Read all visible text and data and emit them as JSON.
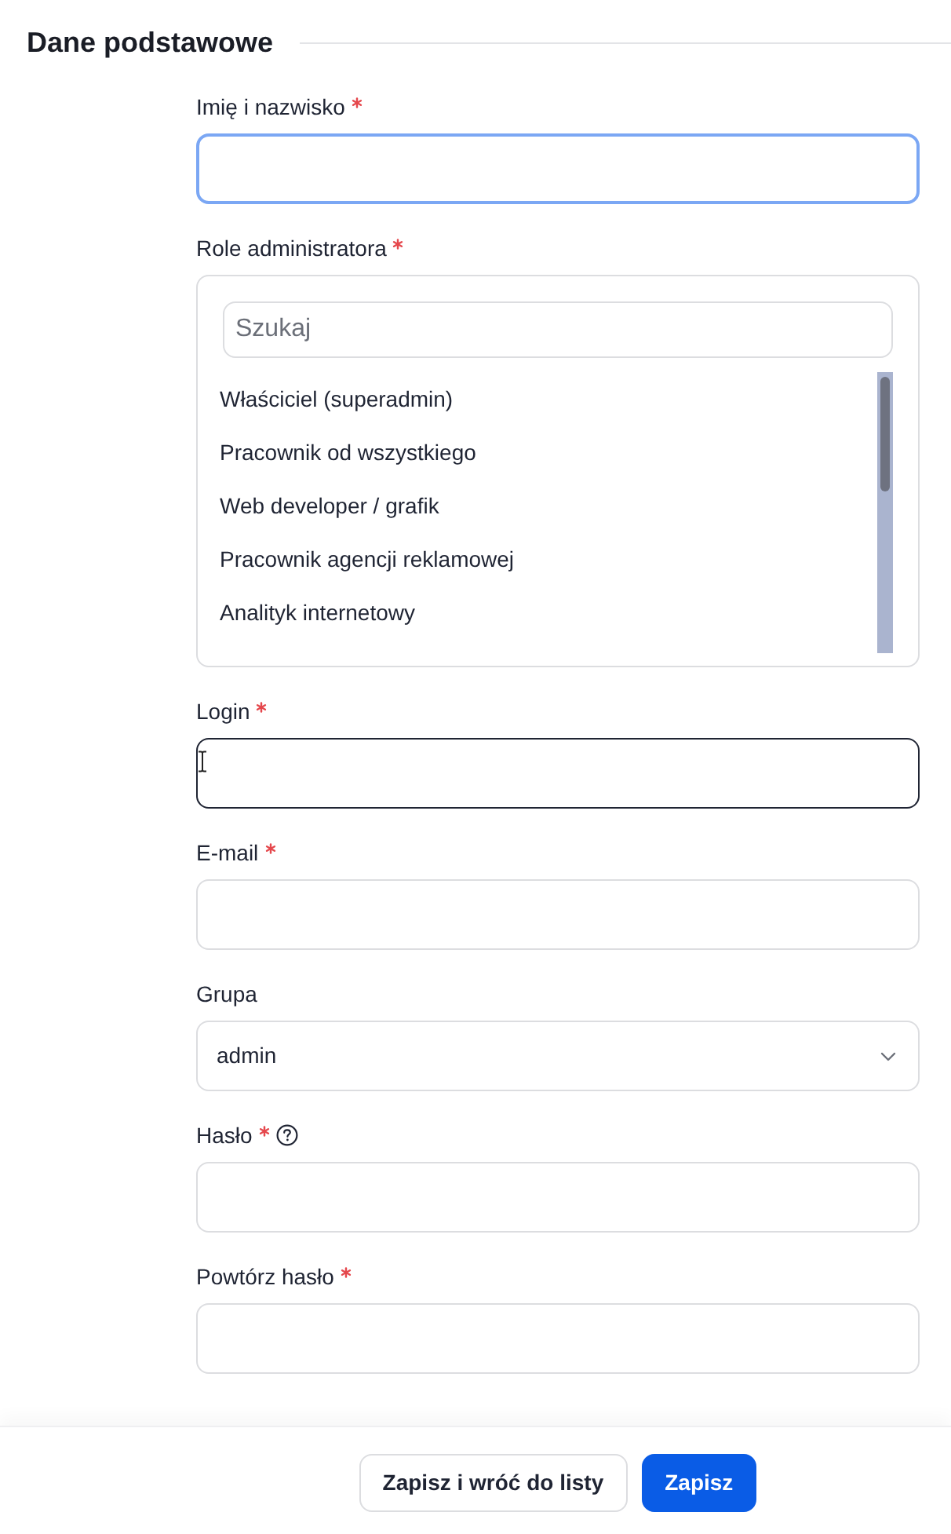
{
  "section": {
    "title": "Dane podstawowe"
  },
  "fields": [
    {
      "kind": "text",
      "label": "Imię i nazwisko",
      "required": true,
      "help": false,
      "focused": true,
      "hovered": false
    },
    {
      "kind": "listbox",
      "label": "Role administratora",
      "required": true,
      "help": false,
      "focused": false,
      "hovered": false,
      "search": {
        "placeholder": "Szukaj"
      },
      "options": [
        {
          "label": "Właściciel (superadmin)"
        },
        {
          "label": "Pracownik od wszystkiego"
        },
        {
          "label": "Web developer / grafik"
        },
        {
          "label": "Pracownik agencji reklamowej"
        },
        {
          "label": "Analityk internetowy"
        }
      ]
    },
    {
      "kind": "text",
      "label": "Login",
      "required": true,
      "help": false,
      "focused": false,
      "hovered": true
    },
    {
      "kind": "text",
      "label": "E-mail",
      "required": true,
      "help": false,
      "focused": false,
      "hovered": false
    },
    {
      "kind": "select",
      "label": "Grupa",
      "required": false,
      "help": false,
      "focused": false,
      "hovered": false,
      "value": "admin"
    },
    {
      "kind": "text",
      "label": "Hasło",
      "required": true,
      "help": true,
      "focused": false,
      "hovered": false
    },
    {
      "kind": "text",
      "label": "Powtórz hasło",
      "required": true,
      "help": false,
      "focused": false,
      "hovered": false
    }
  ],
  "buttons": [
    {
      "label": "Zapisz i wróć do listy",
      "kind": "secondary"
    },
    {
      "label": "Zapisz",
      "kind": "primary"
    }
  ]
}
